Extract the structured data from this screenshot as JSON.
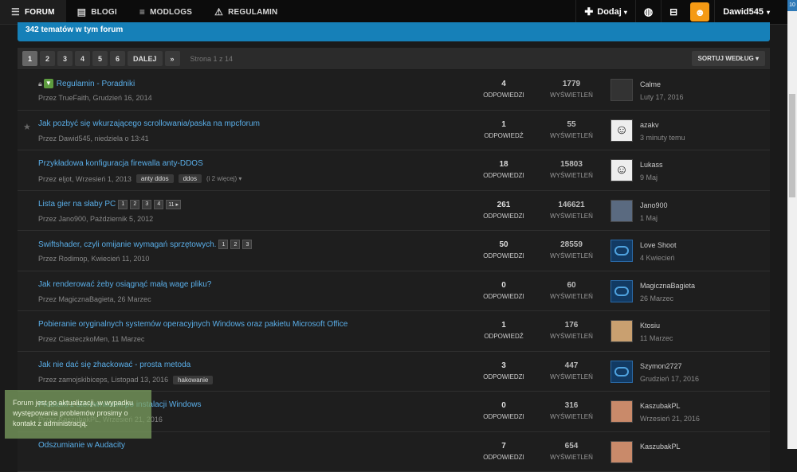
{
  "nav": {
    "items": [
      {
        "label": "FORUM",
        "icon": "menu-icon",
        "glyph": "☰"
      },
      {
        "label": "BLOGI",
        "icon": "book-icon",
        "glyph": "▤"
      },
      {
        "label": "MODLOGS",
        "icon": "list-icon",
        "glyph": "≡"
      },
      {
        "label": "REGULAMIN",
        "icon": "warning-icon",
        "glyph": "⚠"
      }
    ],
    "add_label": "Dodaj",
    "user_label": "Dawid545",
    "corner_badge": "10"
  },
  "banner": {
    "text": "342 tematów w tym forum"
  },
  "pagination": {
    "pages": [
      "1",
      "2",
      "3",
      "4",
      "5",
      "6"
    ],
    "next_label": "DALEJ",
    "last_label": "»",
    "info": "Strona 1 z 14",
    "sort_label": "SORTUJ WEDŁUG"
  },
  "topics": [
    {
      "title": "Regulamin - Poradniki",
      "meta": "Przez TrueFaith, Grudzień 16, 2014",
      "replies": "4",
      "replies_label": "ODPOWIEDZI",
      "views": "1779",
      "views_label": "WYŚWIETLEŃ",
      "last_user": "Calme",
      "last_time": "Luty 17, 2016",
      "avatar": "dark",
      "locked": true,
      "pinned": true
    },
    {
      "title": "Jak pozbyć się wkurzającego scrollowania/paska na mpcforum",
      "meta": "Przez Dawid545, niedziela o 13:41",
      "replies": "1",
      "replies_label": "ODPOWIEDŹ",
      "views": "55",
      "views_label": "WYŚWIETLEŃ",
      "last_user": "azakv",
      "last_time": "3 minuty temu",
      "avatar": "face",
      "star": true
    },
    {
      "title": "Przykładowa konfiguracja firewalla anty-DDOS",
      "meta": "Przez eljot, Wrzesień 1, 2013",
      "tags": [
        "anty ddos",
        "ddos"
      ],
      "more": "(i 2 więcej) ▾",
      "replies": "18",
      "replies_label": "ODPOWIEDZI",
      "views": "15803",
      "views_label": "WYŚWIETLEŃ",
      "last_user": "Lukass",
      "last_time": "9 Maj",
      "avatar": "face"
    },
    {
      "title": "Lista gier na słaby PC",
      "meta": "Przez Jano900, Październik 5, 2012",
      "pages": [
        "1",
        "2",
        "3",
        "4",
        "11 ▸"
      ],
      "replies": "261",
      "replies_label": "ODPOWIEDZI",
      "views": "146621",
      "views_label": "WYŚWIETLEŃ",
      "last_user": "Jano900",
      "last_time": "1 Maj",
      "avatar": "mtn"
    },
    {
      "title": "Swiftshader, czyli omijanie wymagań sprzętowych.",
      "meta": "Przez Rodimop, Kwiecień 11, 2010",
      "pages": [
        "1",
        "2",
        "3"
      ],
      "replies": "50",
      "replies_label": "ODPOWIEDZI",
      "views": "28559",
      "views_label": "WYŚWIETLEŃ",
      "last_user": "Love Shoot",
      "last_time": "4 Kwiecień",
      "avatar": "blue"
    },
    {
      "title": "Jak renderować żeby osiągnąć małą wage pliku?",
      "meta": "Przez MagicznaBagieta, 26 Marzec",
      "replies": "0",
      "replies_label": "ODPOWIEDZI",
      "views": "60",
      "views_label": "WYŚWIETLEŃ",
      "last_user": "MagicznaBagieta",
      "last_time": "26 Marzec",
      "avatar": "blue"
    },
    {
      "title": "Pobieranie oryginalnych systemów operacyjnych Windows oraz pakietu Microsoft Office",
      "meta": "Przez CiasteczkoMen, 11 Marzec",
      "replies": "1",
      "replies_label": "ODPOWIEDŹ",
      "views": "176",
      "views_label": "WYŚWIETLEŃ",
      "last_user": "Ktosiu",
      "last_time": "11 Marzec",
      "avatar": "anim"
    },
    {
      "title": "Jak nie dać się zhackować - prosta metoda",
      "meta": "Przez zamojskibiceps, Listopad 13, 2016",
      "tags": [
        "hakowanie"
      ],
      "replies": "3",
      "replies_label": "ODPOWIEDZI",
      "views": "447",
      "views_label": "WYŚWIETLEŃ",
      "last_user": "Szymon2727",
      "last_time": "Grudzień 17, 2016",
      "avatar": "blue"
    },
    {
      "title": "Problem z sterownikiem po instalacji Windows",
      "meta": "Przez KaszubakPL, Wrzesień 21, 2016",
      "replies": "0",
      "replies_label": "ODPOWIEDZI",
      "views": "316",
      "views_label": "WYŚWIETLEŃ",
      "last_user": "KaszubakPL",
      "last_time": "Wrzesień 21, 2016",
      "avatar": "girl"
    },
    {
      "title": "Odszumianie w Audacity",
      "meta": "",
      "replies": "7",
      "replies_label": "ODPOWIEDZI",
      "views": "654",
      "views_label": "WYŚWIETLEŃ",
      "last_user": "KaszubakPL",
      "last_time": "",
      "avatar": "girl"
    }
  ],
  "toast": {
    "text": "Forum jest po aktualizacji, w wypadku występowania problemów prosimy o kontakt z administracją."
  }
}
